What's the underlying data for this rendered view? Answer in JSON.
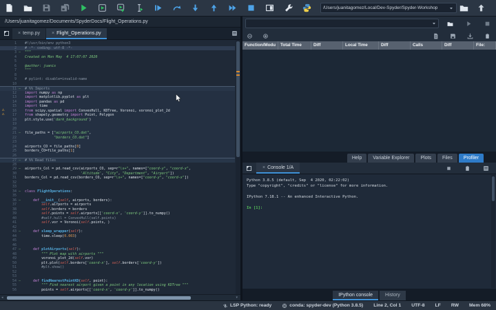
{
  "toolbar": {
    "buttons": [
      "new-file",
      "open-file",
      "save-file",
      "save-all",
      "run-file",
      "run-cell",
      "run-cell-advance",
      "run-selection",
      "debug-file",
      "step-over",
      "step-into",
      "step-return",
      "continue-execution",
      "stop-debug",
      "maximize-pane",
      "preferences",
      "python-logo"
    ],
    "working_dir": "/Users/juanitagomez/Local/Dev-Spyder/Spyder-Workshop",
    "right_icons": [
      "open-dir",
      "parent-dir"
    ]
  },
  "editor": {
    "breadcrumb": "/Users/juanitagomez/Documents/SpyderDocs/Flight_Operations.py",
    "tabs": [
      {
        "label": "temp.py",
        "active": false
      },
      {
        "label": "Flight_Operations.py",
        "active": true
      }
    ],
    "current_line": 2,
    "warning_lines": [
      16,
      17
    ],
    "fold_lines": [
      3,
      11,
      21,
      27,
      29,
      34,
      36,
      43,
      47,
      54
    ],
    "cell_header_lines": [
      11,
      27
    ],
    "highlight_cell": {
      "start": 11,
      "end": 26
    },
    "lines": [
      "#!/usr/bin/env python3",
      "# -*- coding: utf-8 -*-",
      "\"\"\"",
      "Created on Mon May  4 17:07:07 2020",
      "",
      "@author: juanis",
      "\"\"\"",
      "",
      "# pylint: disable=invalid-name",
      "",
      "# %% Imports",
      "import numpy as np",
      "import matplotlib.pyplot as plt",
      "import pandas as pd",
      "import time",
      "from scipy.spatial import ConvexHull, KDTree, Voronoi, voronoi_plot_2d",
      "from shapely.geometry import Point, Polygon",
      "plt.style.use('dark_background')",
      "",
      "",
      "file_paths = [\"airports_CO.dat\",",
      "              \"borders_CO.dat\"]",
      "",
      "airports_CO = file_paths[0]",
      "borders_CO=file_paths[1]",
      "",
      "# %% Read files",
      "",
      "airports_Col = pd.read_csv(airports_CO, sep=r\"\\s+\", names=[\"coord-y\", \"coord-x\",",
      "                           'Altitude', \"City\", \"Department\", \"Airport\"])",
      "borders_Col = pd.read_csv(borders_CO, sep=r\"\\s+\", names=[\"coord-y\", \"coord-x\"])",
      "",
      "",
      "class FlightOperations:",
      "",
      "    def __init__(self, airports, borders):",
      "        self.airports = airports",
      "        self.borders = borders",
      "        self.points = self.airports[['coord-x', 'coord-y']].to_numpy()",
      "        #self.hull = ConvexHull(self.points)",
      "        self.vor = Voronoi(self.points, )",
      "",
      "    def sleep_wrapper(self):",
      "        time.sleep(0.003)",
      "",
      "",
      "    def plotAirports(self):",
      "        \"\"\" Plot map with airports \"\"\"",
      "        voronoi_plot_2d(self.vor)",
      "        plt.plot(self.borders['coord-x'], self.borders['coord-y'])",
      "        #plt.show()",
      "",
      "",
      "    def findNearestPointKD(self, point):",
      "        \"\"\" Find nearest airport given a point in any location using KDTree \"\"\"",
      "        points = self.airports[['coord-x', 'coord-y']].to_numpy()"
    ]
  },
  "profiler": {
    "filter_value": "",
    "toolbar_left": [
      "collapse",
      "expand"
    ],
    "run_controls": [
      "open-dir",
      "start-profiling",
      "stop-profiling"
    ],
    "toolbar_right": [
      "output-file",
      "save-data",
      "load-data",
      "copy"
    ],
    "columns": [
      "Function/Modu",
      "Total Time",
      "Diff",
      "Local Time",
      "Diff",
      "Calls",
      "Diff",
      "File:"
    ],
    "rows": []
  },
  "pane_tabs": [
    {
      "label": "Help",
      "active": false
    },
    {
      "label": "Variable Explorer",
      "active": false
    },
    {
      "label": "Plots",
      "active": false
    },
    {
      "label": "Files",
      "active": false
    },
    {
      "label": "Profiler",
      "active": true
    }
  ],
  "console": {
    "tab_label": "Console 1/A",
    "header_icons": [
      "inspect",
      "copy",
      "options"
    ],
    "banner": [
      "Python 3.8.5 (default, Sep  4 2020, 02:22:02)",
      "Type \"copyright\", \"credits\" or \"license\" for more information.",
      "",
      "IPython 7.18.1 -- An enhanced Interactive Python.",
      ""
    ],
    "prompt": "In [1]:",
    "bottom_tabs": [
      {
        "label": "IPython console",
        "active": true
      },
      {
        "label": "History",
        "active": false
      }
    ]
  },
  "statusbar": {
    "lsp": "LSP Python: ready",
    "env": "conda: spyder-dev (Python 3.8.5)",
    "cursor": "Line 2, Col 1",
    "encoding": "UTF-8",
    "eol": "LF",
    "permissions": "RW",
    "memory": "Mem 68%"
  }
}
